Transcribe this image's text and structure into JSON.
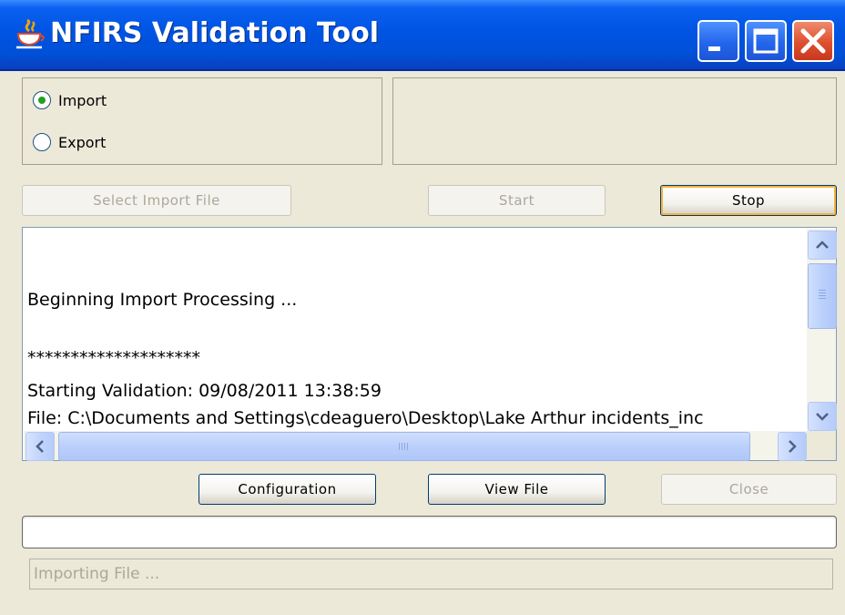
{
  "window": {
    "title": "NFIRS Validation Tool",
    "icon": "java-cup-icon",
    "controls": [
      "minimize-icon",
      "maximize-icon",
      "close-icon"
    ]
  },
  "mode": {
    "options": [
      {
        "label": "Import",
        "selected": true
      },
      {
        "label": "Export",
        "selected": false
      }
    ]
  },
  "toolbar": {
    "select_import_file_label": "Select Import File",
    "start_label": "Start",
    "stop_label": "Stop"
  },
  "log": {
    "lines": [
      "",
      "",
      "Beginning Import Processing ...",
      "",
      "********************",
      "Starting Validation: 09/08/2011 13:38:59",
      "File: C:\\Documents and Settings\\cdeaguero\\Desktop\\Lake Arthur incidents_inc"
    ]
  },
  "actions": {
    "configuration_label": "Configuration",
    "view_file_label": "View File",
    "close_label": "Close"
  },
  "progress": {
    "value": 0
  },
  "status": {
    "text": "Importing File ..."
  },
  "colors": {
    "titlebar": "#0054E3",
    "window_bg": "#ECE9D8",
    "radio_dot": "#21A121",
    "focus_ring": "#F8B33A",
    "disabled_text": "#ACA899"
  }
}
